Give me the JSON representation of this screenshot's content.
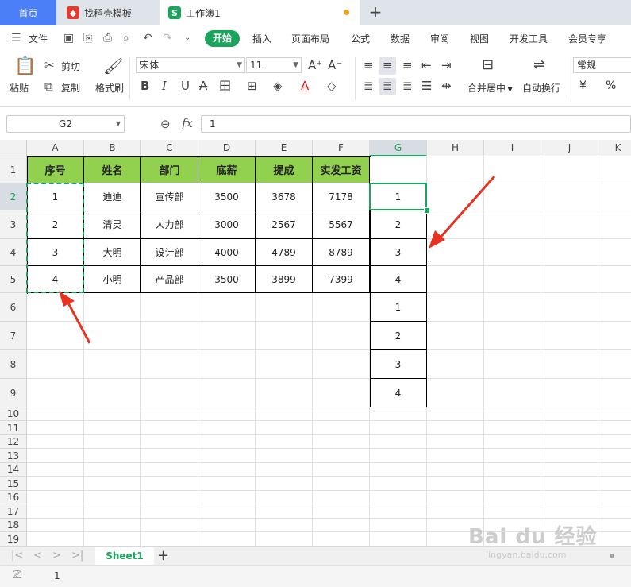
{
  "tabs": {
    "home": "首页",
    "template": "找稻壳模板",
    "workbook": "工作簿1",
    "new_tab": "+"
  },
  "menu": {
    "file": "文件",
    "items": [
      "开始",
      "插入",
      "页面布局",
      "公式",
      "数据",
      "审阅",
      "视图",
      "开发工具",
      "会员专享"
    ]
  },
  "ribbon": {
    "paste": "粘贴",
    "cut": "剪切",
    "copy": "复制",
    "format_painter": "格式刷",
    "font_name": "宋体",
    "font_size": "11",
    "merge_center": "合并居中",
    "wrap_text": "自动换行",
    "number_format": "常规",
    "currency_symbol": "¥",
    "percent_symbol": "%"
  },
  "formula_bar": {
    "name_box": "G2",
    "fx": "fx",
    "value": "1"
  },
  "grid": {
    "columns": [
      "A",
      "B",
      "C",
      "D",
      "E",
      "F",
      "G",
      "H",
      "I",
      "J",
      "K"
    ],
    "rows": [
      "1",
      "2",
      "3",
      "4",
      "5",
      "6",
      "7",
      "8",
      "9",
      "10",
      "11",
      "12",
      "13",
      "14",
      "15",
      "16",
      "17",
      "18",
      "19"
    ],
    "active_column": "G",
    "active_row": "2"
  },
  "table": {
    "headers": [
      "序号",
      "姓名",
      "部门",
      "底薪",
      "提成",
      "实发工资"
    ],
    "rows": [
      [
        "1",
        "迪迪",
        "宣传部",
        "3500",
        "3678",
        "7178"
      ],
      [
        "2",
        "清灵",
        "人力部",
        "3000",
        "2567",
        "5567"
      ],
      [
        "3",
        "大明",
        "设计部",
        "4000",
        "4789",
        "8789"
      ],
      [
        "4",
        "小明",
        "产品部",
        "3500",
        "3899",
        "7399"
      ]
    ]
  },
  "column_g": [
    "1",
    "2",
    "3",
    "4",
    "1",
    "2",
    "3",
    "4"
  ],
  "sheets": {
    "active": "Sheet1",
    "add": "+"
  },
  "status": {
    "value": "1"
  },
  "watermark": {
    "brand": "Bai du 经验",
    "url": "jingyan.baidu.com"
  },
  "colors": {
    "accent": "#1aa45c",
    "home_tab": "#4a7ff7",
    "header_fill": "#92d050",
    "arrow": "#e8311e"
  }
}
